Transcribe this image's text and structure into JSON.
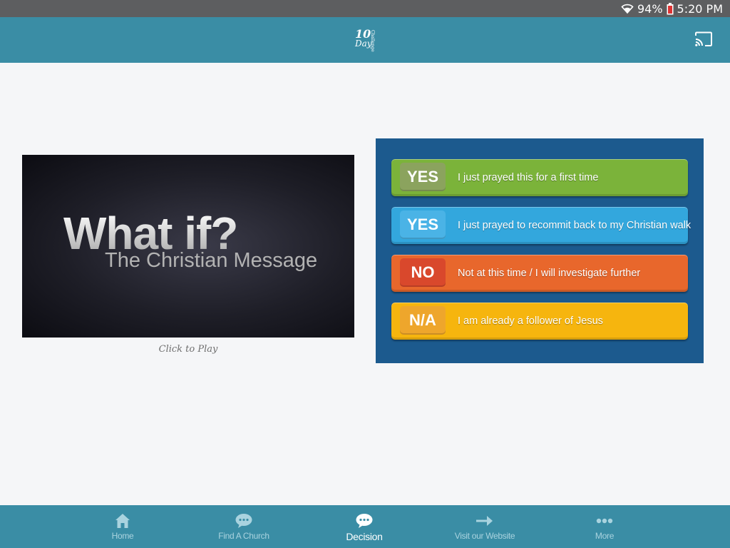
{
  "status": {
    "battery": "94%",
    "time": "5:20 PM",
    "icons": [
      "wifi-icon",
      "battery-icon"
    ]
  },
  "appbar": {
    "logo_number": "10",
    "logo_word": "Day",
    "logo_small": "Challenge",
    "cast_icon": "cast-icon"
  },
  "video": {
    "title": "What if?",
    "subtitle": "The Christian Message",
    "caption": "Click to Play"
  },
  "decision": {
    "background": "#1c5a8e",
    "options": [
      {
        "badge": "YES",
        "label": "I just prayed this for a first time",
        "color": "#7bb33a",
        "badge_color": "#8ba35e"
      },
      {
        "badge": "YES",
        "label": "I just prayed to recommit back to my Christian walk",
        "color": "#33a7dd",
        "badge_color": "#4ab3e6"
      },
      {
        "badge": "NO",
        "label": "Not at this time / I will investigate further",
        "color": "#e8672c",
        "badge_color": "#d9482c"
      },
      {
        "badge": "N/A",
        "label": "I am already a follower of Jesus",
        "color": "#f6b50e",
        "badge_color": "#eea62c"
      }
    ]
  },
  "nav": {
    "items": [
      {
        "label": "Home",
        "icon": "home-icon"
      },
      {
        "label": "Find A Church",
        "icon": "chat-bubble-icon"
      },
      {
        "label": "Decision",
        "icon": "chat-bubble-icon",
        "active": true
      },
      {
        "label": "Visit our Website",
        "icon": "arrow-right-icon"
      },
      {
        "label": "More",
        "icon": "more-dots-icon"
      }
    ]
  },
  "colors": {
    "appbar": "#3a8da5",
    "statusbar": "#5d5e60",
    "content_bg": "#f5f6f8"
  }
}
